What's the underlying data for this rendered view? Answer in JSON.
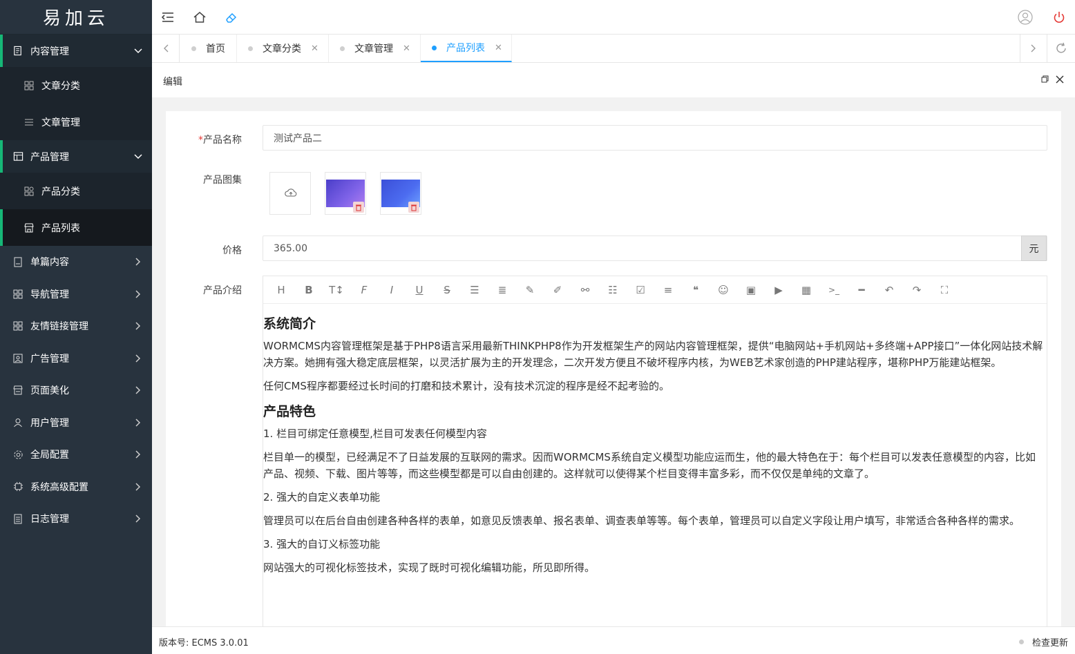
{
  "logo": "易加云",
  "sidebar": {
    "items": [
      {
        "label": "内容管理",
        "icon": "content-icon"
      },
      {
        "label": "文章分类",
        "icon": "grid-icon"
      },
      {
        "label": "文章管理",
        "icon": "list-icon"
      },
      {
        "label": "产品管理",
        "icon": "product-icon"
      },
      {
        "label": "产品分类",
        "icon": "grid-icon"
      },
      {
        "label": "产品列表",
        "icon": "store-icon"
      },
      {
        "label": "单篇内容",
        "icon": "page-icon"
      },
      {
        "label": "导航管理",
        "icon": "grid-icon"
      },
      {
        "label": "友情链接管理",
        "icon": "grid-icon"
      },
      {
        "label": "广告管理",
        "icon": "image-icon"
      },
      {
        "label": "页面美化",
        "icon": "store-icon"
      },
      {
        "label": "用户管理",
        "icon": "user-icon"
      },
      {
        "label": "全局配置",
        "icon": "gear-icon"
      },
      {
        "label": "系统高级配置",
        "icon": "chip-icon"
      },
      {
        "label": "日志管理",
        "icon": "log-icon"
      }
    ]
  },
  "tabs": [
    {
      "label": "首页"
    },
    {
      "label": "文章分类"
    },
    {
      "label": "文章管理"
    },
    {
      "label": "产品列表"
    }
  ],
  "panel": {
    "title": "编辑"
  },
  "form": {
    "name_label": "产品名称",
    "name_required": "*",
    "name_value": "测试产品二",
    "gallery_label": "产品图集",
    "price_label": "价格",
    "price_value": "365.00",
    "price_suffix": "元",
    "intro_label": "产品介绍"
  },
  "editor": {
    "toolbar": [
      "H",
      "B",
      "TI",
      "F",
      "I",
      "U",
      "S",
      "indent",
      "align",
      "pen",
      "brush",
      "link",
      "ul",
      "check",
      "align-left",
      "quote",
      "emoji",
      "image",
      "video",
      "table",
      "code",
      "hr",
      "undo",
      "redo",
      "fullscreen"
    ],
    "h1": "系统简介",
    "p1": "WORMCMS内容管理框架是基于PHP8语言采用最新THINKPHP8作为开发框架生产的网站内容管理框架，提供“电脑网站+手机网站+多终端+APP接口”一体化网站技术解决方案。她拥有强大稳定底层框架，以灵活扩展为主的开发理念，二次开发方便且不破坏程序内核，为WEB艺术家创造的PHP建站程序，堪称PHP万能建站框架。",
    "p2": "任何CMS程序都要经过长时间的打磨和技术累计，没有技术沉淀的程序是经不起考验的。",
    "h2": "产品特色",
    "p3": "1. 栏目可绑定任意模型,栏目可发表任何模型内容",
    "p4": "栏目单一的模型，已经满足不了日益发展的互联网的需求。因而WORMCMS系统自定义模型功能应运而生，他的最大特色在于：每个栏目可以发表任意模型的内容，比如产品、视频、下载、图片等等，而这些模型都是可以自由创建的。这样就可以使得某个栏目变得丰富多彩，而不仅仅是单纯的文章了。",
    "p5": "2. 强大的自定义表单功能",
    "p6": "管理员可以在后台自由创建各种各样的表单，如意见反馈表单、报名表单、调查表单等等。每个表单，管理员可以自定义字段让用户填写，非常适合各种各样的需求。",
    "p7": "3. 强大的自订义标签功能",
    "p8": "网站强大的可视化标签技术，实现了既时可视化编辑功能，所见即所得。"
  },
  "footer": {
    "version": "版本号: ECMS 3.0.01",
    "update": "检查更新"
  },
  "colors": {
    "accent": "#1e9fff",
    "sidebar": "#28333e",
    "active_bar": "#16b777"
  }
}
